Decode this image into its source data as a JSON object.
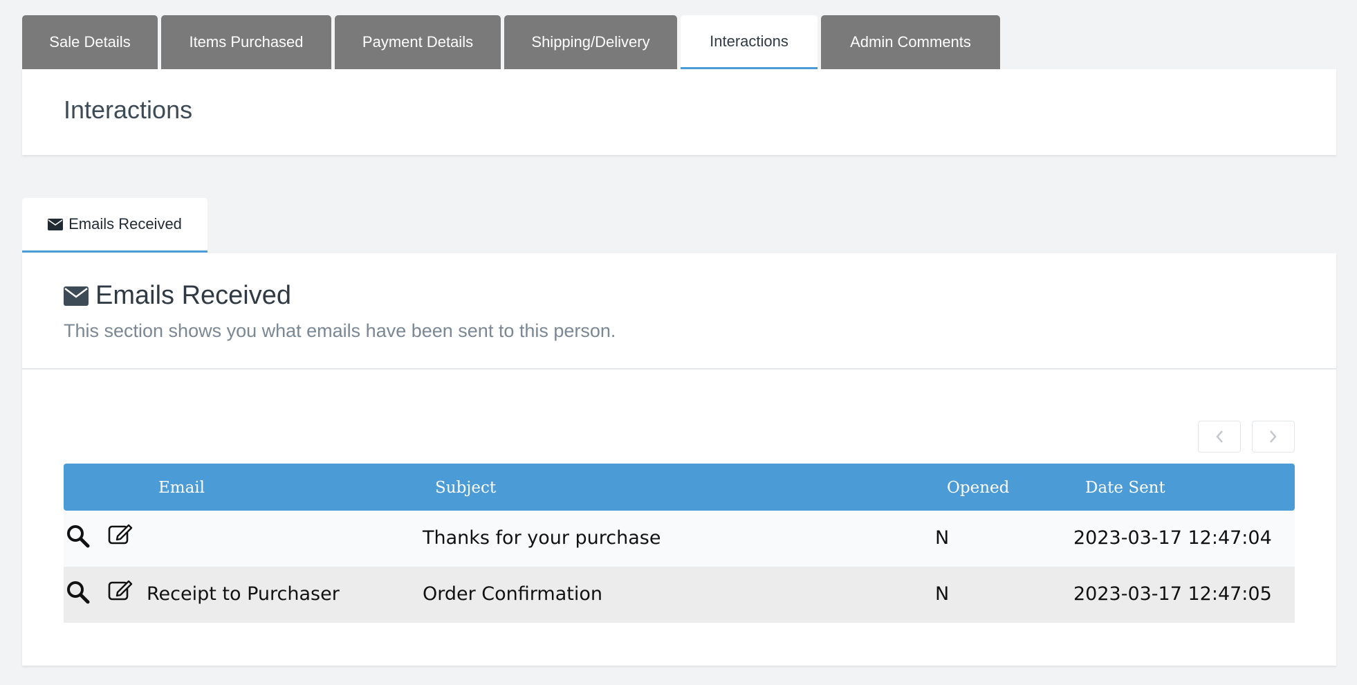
{
  "tabs": [
    {
      "label": "Sale Details"
    },
    {
      "label": "Items Purchased"
    },
    {
      "label": "Payment Details"
    },
    {
      "label": "Shipping/Delivery"
    },
    {
      "label": "Interactions"
    },
    {
      "label": "Admin Comments"
    }
  ],
  "active_tab": "Interactions",
  "page_title": "Interactions",
  "subtab": {
    "label": "Emails Received",
    "icon": "envelope-icon"
  },
  "section": {
    "title": "Emails Received",
    "description": "This section shows you what emails have been sent to this person."
  },
  "table": {
    "headers": {
      "email": "Email",
      "subject": "Subject",
      "opened": "Opened",
      "date_sent": "Date Sent"
    },
    "rows": [
      {
        "email": "",
        "subject": "Thanks for your purchase",
        "opened": "N",
        "date_sent": "2023-03-17 12:47:04"
      },
      {
        "email": "Receipt to Purchaser",
        "subject": "Order Confirmation",
        "opened": "N",
        "date_sent": "2023-03-17 12:47:05"
      }
    ]
  },
  "colors": {
    "accent": "#4a9bd6",
    "tab_inactive": "#7a7a7a",
    "background": "#f2f3f5"
  }
}
